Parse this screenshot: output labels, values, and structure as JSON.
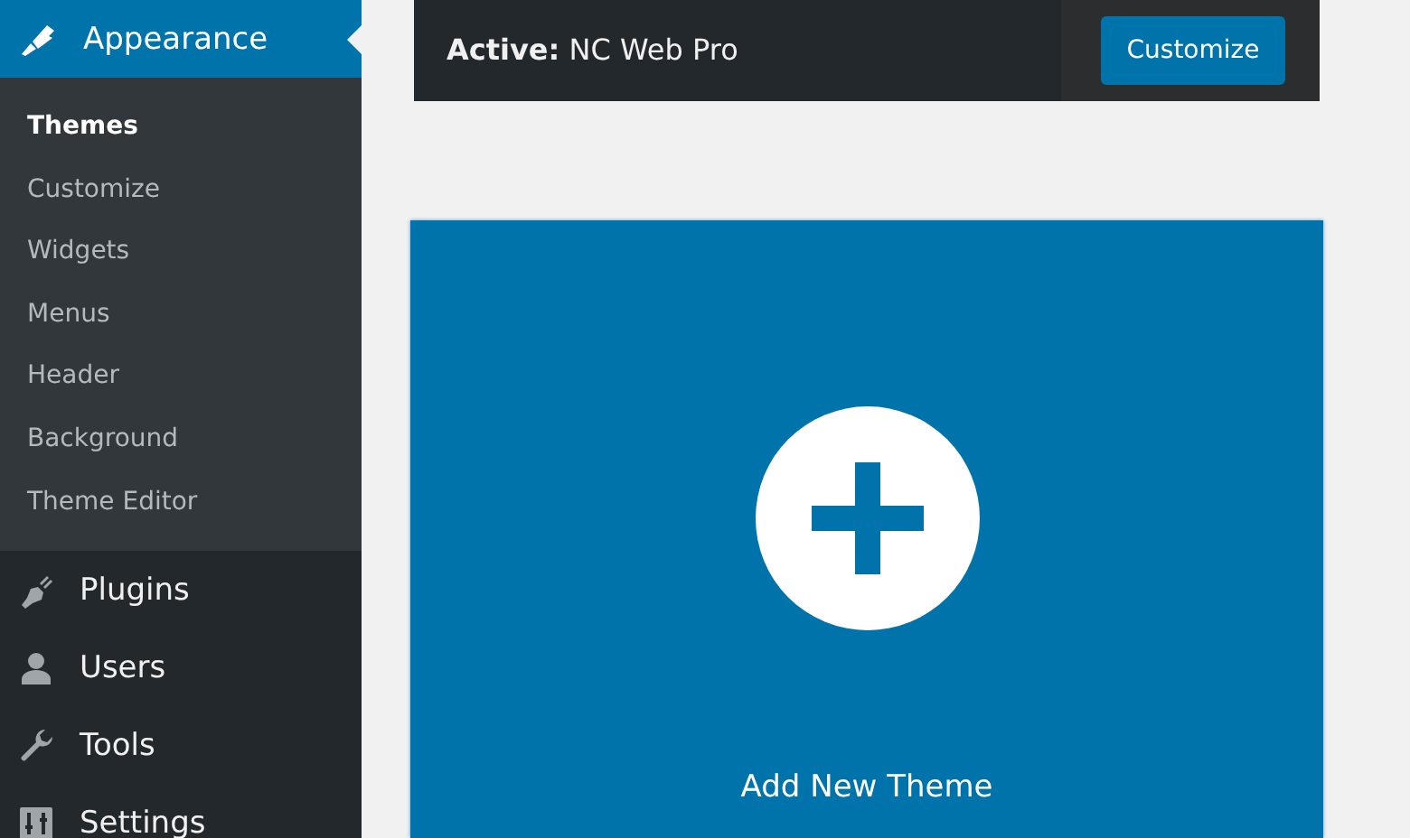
{
  "sidebar": {
    "items": [
      {
        "label": "Appearance",
        "selected": true,
        "children": [
          {
            "label": "Themes",
            "selected": true
          },
          {
            "label": "Customize",
            "selected": false
          },
          {
            "label": "Widgets",
            "selected": false
          },
          {
            "label": "Menus",
            "selected": false
          },
          {
            "label": "Header",
            "selected": false
          },
          {
            "label": "Background",
            "selected": false
          },
          {
            "label": "Theme Editor",
            "selected": false
          }
        ]
      },
      {
        "label": "Plugins",
        "selected": false
      },
      {
        "label": "Users",
        "selected": false
      },
      {
        "label": "Tools",
        "selected": false
      },
      {
        "label": "Settings",
        "selected": false
      }
    ]
  },
  "active_theme": {
    "text": "**Active:** NC Web Pro",
    "button": "Customize"
  },
  "add_new": {
    "label": "Add New Theme"
  }
}
